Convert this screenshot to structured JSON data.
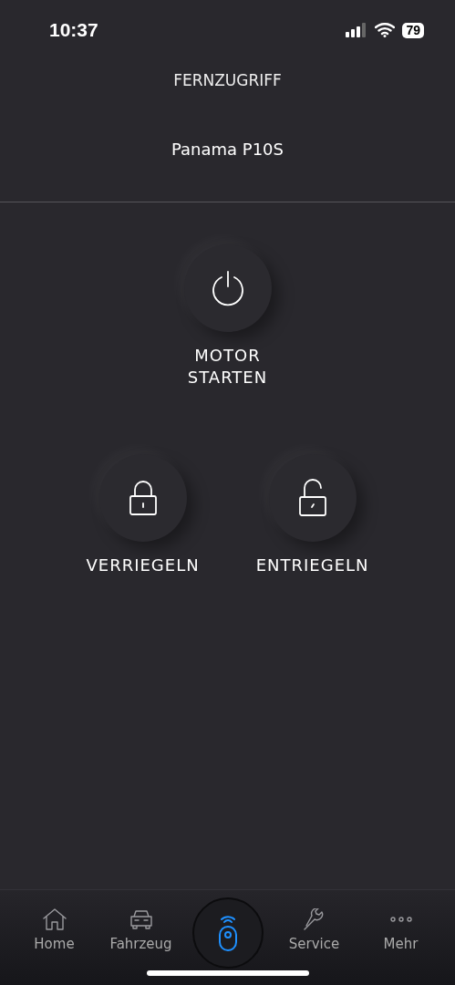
{
  "status_bar": {
    "time": "10:37",
    "battery": "79"
  },
  "header": {
    "title": "FERNZUGRIFF",
    "vehicle": "Panama P10S"
  },
  "actions": [
    {
      "kind": "power",
      "label": "MOTOR\nSTARTEN"
    },
    {
      "kind": "lock",
      "label": "VERRIEGELN"
    },
    {
      "kind": "unlock",
      "label": "ENTRIEGELN"
    }
  ],
  "tab_bar": [
    {
      "kind": "home",
      "label": "Home",
      "selected": false
    },
    {
      "kind": "car",
      "label": "Fahrzeug",
      "selected": false
    },
    {
      "kind": "remote",
      "selected": true
    },
    {
      "kind": "wrench",
      "label": "Service",
      "selected": false
    },
    {
      "kind": "more",
      "label": "Mehr",
      "selected": false
    }
  ]
}
